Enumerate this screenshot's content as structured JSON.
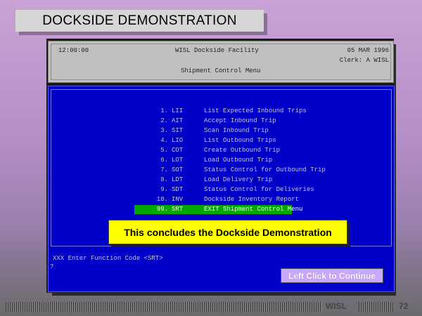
{
  "slide": {
    "title": "DOCKSIDE DEMONSTRATION",
    "message": "This concludes the Dockside Demonstration",
    "continue_label": "Left Click to Continue",
    "footer_brand": "WISL",
    "page_number": "72"
  },
  "header": {
    "time": "12:00:00",
    "facility": "WISL Dockside Facility",
    "date": "05 MAR 1996",
    "clerk": "Clerk: A WISL",
    "menu_title": "Shipment Control Menu"
  },
  "menu": {
    "items": [
      {
        "num": "1.",
        "code": "LII",
        "desc": "List Expected Inbound Trips"
      },
      {
        "num": "2.",
        "code": "AIT",
        "desc": "Accept Inbound Trip"
      },
      {
        "num": "3.",
        "code": "SIT",
        "desc": "Scan Inbound Trip"
      },
      {
        "num": "4.",
        "code": "LIO",
        "desc": "List Outbound Trips"
      },
      {
        "num": "5.",
        "code": "COT",
        "desc": "Create Outbound Trip"
      },
      {
        "num": "6.",
        "code": "LOT",
        "desc": "Load Outbound Trip"
      },
      {
        "num": "7.",
        "code": "SOT",
        "desc": "Status Control for Outbound Trip"
      },
      {
        "num": "8.",
        "code": "LDT",
        "desc": "Load Delivery Trip"
      },
      {
        "num": "9.",
        "code": "SDT",
        "desc": "Status Control for Deliveries"
      },
      {
        "num": "10.",
        "code": "INV",
        "desc": "Dockside Inventory Report"
      },
      {
        "num": "99.",
        "code": "SRT",
        "desc": "EXIT Shipment Control Menu"
      }
    ],
    "prompt": "XXX Enter Function Code <SRT>",
    "cursor": "?"
  },
  "colors": {
    "terminal_bg": "#0000c8",
    "highlight": "#00a800",
    "message_bg": "#ffff00"
  }
}
